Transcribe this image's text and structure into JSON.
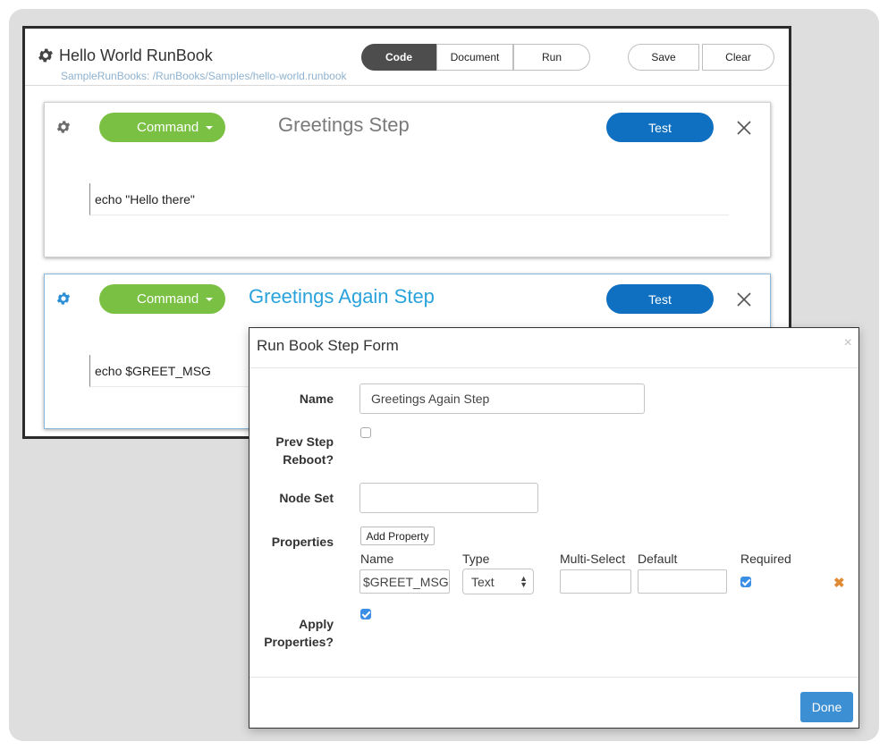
{
  "app": {
    "title": "Hello World RunBook",
    "subtitle": "SampleRunBooks: /RunBooks/Samples/hello-world.runbook",
    "tabs": {
      "code": "Code",
      "document": "Document",
      "run": "Run"
    },
    "save_label": "Save",
    "clear_label": "Clear"
  },
  "steps": [
    {
      "type_label": "Command",
      "title": "Greetings Step",
      "test_label": "Test",
      "code": "echo \"Hello there\""
    },
    {
      "type_label": "Command",
      "title": "Greetings Again Step",
      "test_label": "Test",
      "code": "echo $GREET_MSG"
    }
  ],
  "modal": {
    "title": "Run Book Step Form",
    "close_glyph": "×",
    "name_label": "Name",
    "name_value": "Greetings Again Step",
    "prev_step_label_1": "Prev Step",
    "prev_step_label_2": "Reboot?",
    "node_set_label": "Node Set",
    "node_set_value": "",
    "properties_label": "Properties",
    "add_property_label": "Add Property",
    "columns": {
      "name": "Name",
      "type": "Type",
      "multi_select": "Multi-Select",
      "default": "Default",
      "required": "Required"
    },
    "property_row": {
      "name": "$GREET_MSG",
      "type": "Text",
      "multi_select": "",
      "default": "",
      "required": true,
      "remove_glyph": "✖"
    },
    "apply_label_1": "Apply",
    "apply_label_2": "Properties?",
    "apply_checked": true,
    "prev_step_checked": false,
    "done_label": "Done"
  },
  "colors": {
    "command_green": "#7ac143",
    "test_blue": "#0f6fc0",
    "active_title": "#2aa3dc",
    "done_blue": "#3c8fd3"
  }
}
